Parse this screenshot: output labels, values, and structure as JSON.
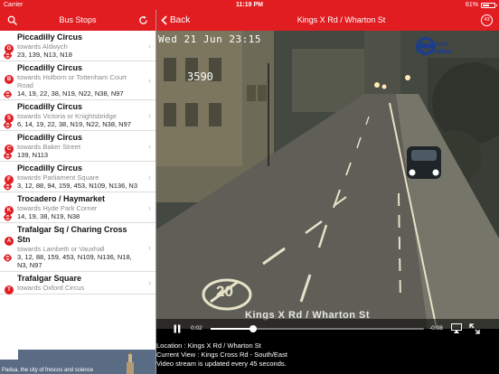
{
  "status_bar": {
    "carrier": "Carrier",
    "time": "11:19 PM",
    "battery_pct": "61%",
    "battery_level": 0.61
  },
  "left_header": {
    "title": "Bus Stops"
  },
  "stops": [
    {
      "letter": "G",
      "name": "Piccadilly Circus",
      "towards": "towards Aldwych",
      "routes": "23, 139, N13, N18"
    },
    {
      "letter": "B",
      "name": "Piccadilly Circus",
      "towards": "towards Holborn or Tottenham Court Road",
      "routes": "14, 19, 22, 38, N19, N22, N38, N97"
    },
    {
      "letter": "S",
      "name": "Piccadilly Circus",
      "towards": "towards Victoria or Knightsbridge",
      "routes": "6, 14, 19, 22, 38, N19, N22, N38, N97"
    },
    {
      "letter": "C",
      "name": "Piccadilly Circus",
      "towards": "towards Baker Street",
      "routes": "139, N113"
    },
    {
      "letter": "F",
      "name": "Piccadilly Circus",
      "towards": "towards Parliament Square",
      "routes": "3, 12, 88, 94, 159, 453, N109, N136, N3"
    },
    {
      "letter": "K",
      "name": "Trocadero / Haymarket",
      "towards": "towards Hyde Park Corner",
      "routes": "14, 19, 38, N19, N38"
    },
    {
      "letter": "A",
      "name": "Trafalgar Sq / Charing Cross Stn",
      "towards": "towards Lambeth or Vauxhall",
      "routes": "3, 12, 88, 159, 453, N109, N136, N18, N3, N97"
    },
    {
      "letter": "T",
      "name": "Trafalgar Square",
      "towards": "towards Oxford Circus",
      "routes": ""
    }
  ],
  "ad": {
    "text": "Padua, the city of frescos and science"
  },
  "right_header": {
    "back_label": "Back",
    "title": "Kings X Rd / Wharton St",
    "badge": "43"
  },
  "camera": {
    "timestamp": "Wed 21 Jun 23:15",
    "camera_number": "3590",
    "tfl_line1": "Transport",
    "tfl_line2": "for London",
    "road_overlay": "Kings X Rd / Wharton St",
    "road_marking": "20"
  },
  "player": {
    "time_elapsed": "0:02",
    "time_remaining": "-0:08",
    "progress": 0.2
  },
  "info": {
    "location": "Location : Kings X Rd / Wharton St",
    "current_view": "Current View : Kings Cross Rd - South/East",
    "update_note": "Video stream is updated every 45 seconds."
  },
  "colors": {
    "accent": "#e11d22",
    "tfl_blue": "#1c3d8c"
  }
}
